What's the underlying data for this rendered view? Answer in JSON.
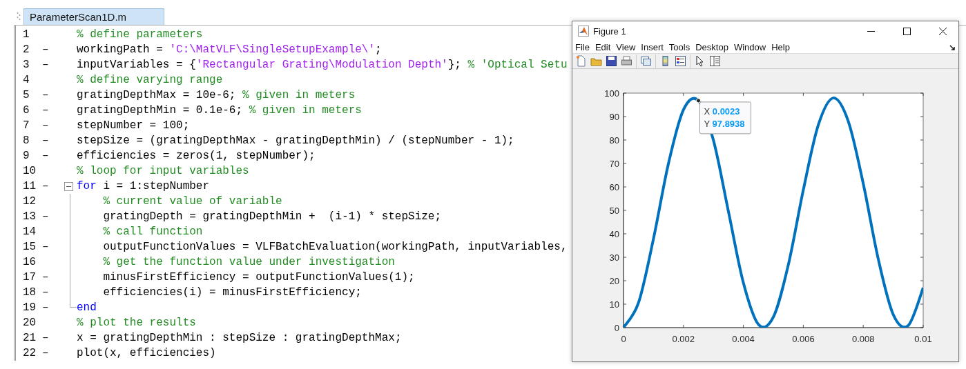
{
  "editor": {
    "tabs": [
      {
        "label": "ParameterScan1D.m",
        "selected": true
      }
    ],
    "lines": [
      {
        "number": "1",
        "segments": [
          {
            "kind": "comment",
            "text": "% define parameters"
          }
        ]
      },
      {
        "number": "2",
        "marker": "–",
        "segments": [
          {
            "kind": "code",
            "text": "workingPath = "
          },
          {
            "kind": "string",
            "text": "'C:\\MatVLF\\SingleSetupExample\\'"
          },
          {
            "kind": "code",
            "text": ";"
          }
        ]
      },
      {
        "number": "3",
        "marker": "–",
        "segments": [
          {
            "kind": "code",
            "text": "inputVariables = {"
          },
          {
            "kind": "string",
            "text": "'Rectangular Grating\\Modulation Depth'"
          },
          {
            "kind": "code",
            "text": "}; "
          },
          {
            "kind": "comment",
            "text": "% 'Optical Setu"
          }
        ]
      },
      {
        "number": "4",
        "segments": [
          {
            "kind": "comment",
            "text": "% define varying range"
          }
        ]
      },
      {
        "number": "5",
        "marker": "–",
        "segments": [
          {
            "kind": "code",
            "text": "gratingDepthMax = 10e-6; "
          },
          {
            "kind": "comment",
            "text": "% given in meters"
          }
        ]
      },
      {
        "number": "6",
        "marker": "–",
        "segments": [
          {
            "kind": "code",
            "text": "gratingDepthMin = 0.1e-6; "
          },
          {
            "kind": "comment",
            "text": "% given in meters"
          }
        ]
      },
      {
        "number": "7",
        "marker": "–",
        "segments": [
          {
            "kind": "code",
            "text": "stepNumber = 100;"
          }
        ]
      },
      {
        "number": "8",
        "marker": "–",
        "segments": [
          {
            "kind": "code",
            "text": "stepSize = (gratingDepthMax - gratingDepthMin) / (stepNumber - 1);"
          }
        ]
      },
      {
        "number": "9",
        "marker": "–",
        "segments": [
          {
            "kind": "code",
            "text": "efficiencies = zeros(1, stepNumber);"
          }
        ]
      },
      {
        "number": "10",
        "segments": [
          {
            "kind": "comment",
            "text": "% loop for input variables"
          }
        ]
      },
      {
        "number": "11",
        "marker": "–",
        "expanded": true,
        "segments": [
          {
            "kind": "keyword",
            "text": "for"
          },
          {
            "kind": "code",
            "text": " i = 1:stepNumber"
          }
        ],
        "children": [
          {
            "number": "12",
            "segments": [
              {
                "kind": "comment",
                "text": "% current value of variable"
              }
            ]
          },
          {
            "number": "13",
            "marker": "–",
            "segments": [
              {
                "kind": "code",
                "text": "gratingDepth = gratingDepthMin +  (i-1) * stepSize;"
              }
            ]
          },
          {
            "number": "14",
            "segments": [
              {
                "kind": "comment",
                "text": "% call function"
              }
            ]
          },
          {
            "number": "15",
            "marker": "–",
            "segments": [
              {
                "kind": "code",
                "text": "outputFunctionValues = VLFBatchEvaluation(workingPath, inputVariables,"
              }
            ]
          },
          {
            "number": "16",
            "segments": [
              {
                "kind": "comment",
                "text": "% get the function value under investigation"
              }
            ]
          },
          {
            "number": "17",
            "marker": "–",
            "segments": [
              {
                "kind": "code",
                "text": "minusFirstEfficiency = outputFunctionValues(1);"
              }
            ]
          },
          {
            "number": "18",
            "marker": "–",
            "segments": [
              {
                "kind": "code",
                "text": "efficiencies(i) = minusFirstEfficiency;"
              }
            ]
          }
        ]
      },
      {
        "number": "19",
        "marker": "–",
        "segments": [
          {
            "kind": "keyword",
            "text": "end"
          }
        ]
      },
      {
        "number": "20",
        "segments": [
          {
            "kind": "comment",
            "text": "% plot the results"
          }
        ]
      },
      {
        "number": "21",
        "marker": "–",
        "segments": [
          {
            "kind": "code",
            "text": "x = gratingDepthMin : stepSize : gratingDepthMax;"
          }
        ]
      },
      {
        "number": "22",
        "marker": "–",
        "segments": [
          {
            "kind": "code",
            "text": "plot(x, efficiencies)"
          }
        ]
      }
    ]
  },
  "figure": {
    "title": "Figure 1",
    "menu": [
      "File",
      "Edit",
      "View",
      "Insert",
      "Tools",
      "Desktop",
      "Window",
      "Help"
    ],
    "plot": {
      "chart_data": {
        "type": "line",
        "x": [
          0,
          0.0005,
          0.001,
          0.0015,
          0.002,
          0.0025,
          0.003,
          0.0035,
          0.004,
          0.0045,
          0.005,
          0.0055,
          0.006,
          0.0065,
          0.007,
          0.0075,
          0.008,
          0.0085,
          0.009,
          0.0095,
          0.01
        ],
        "series": [
          {
            "color": "#0072bd",
            "values": [
              0,
              10.6,
              37.9,
              70.0,
              92.9,
              96.8,
              79.9,
              49.6,
              19.1,
              1.4,
              4.5,
              26.8,
              58.7,
              86.4,
              97.9,
              88.0,
              61.4,
              29.3,
              5.6,
              0.9,
              17.0
            ]
          }
        ],
        "xlim": [
          0,
          0.01
        ],
        "ylim": [
          0,
          100
        ],
        "xticks": [
          0,
          0.002,
          0.004,
          0.006,
          0.008,
          0.01
        ],
        "yticks": [
          0,
          10,
          20,
          30,
          40,
          50,
          60,
          70,
          80,
          90,
          100
        ]
      },
      "datatip": {
        "x_label": "X",
        "x_value": "0.0023",
        "y_label": "Y",
        "y_value": "97.8938"
      }
    }
  }
}
